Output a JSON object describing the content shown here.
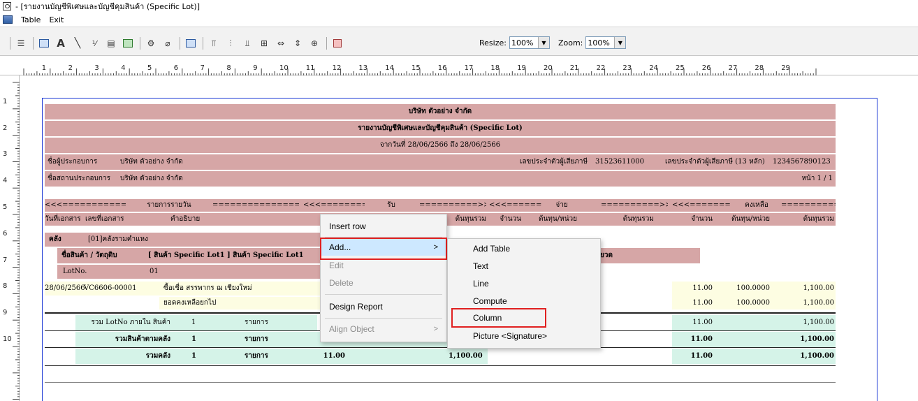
{
  "window": {
    "title": " - [รายงานบัญชีพิเศษและบัญชีคุมสินค้า (Specific Lot)]"
  },
  "menubar": {
    "items": [
      "Table",
      "Exit"
    ]
  },
  "toolbar": {
    "resize_label": "Resize:",
    "resize_value": "100%",
    "zoom_label": "Zoom:",
    "zoom_value": "100%"
  },
  "ruler": {
    "h_marks": [
      "1",
      "2",
      "3",
      "4",
      "5",
      "6",
      "7",
      "8",
      "9",
      "10",
      "11",
      "12",
      "13",
      "14",
      "15",
      "16",
      "17",
      "18",
      "19",
      "20",
      "21",
      "22",
      "23",
      "24",
      "25",
      "26",
      "27",
      "28",
      "29"
    ],
    "v_marks": [
      "1",
      "2",
      "3",
      "4",
      "5",
      "6",
      "7",
      "8",
      "9",
      "10"
    ]
  },
  "report": {
    "company": "บริษัท ตัวอย่าง จำกัด",
    "title": "รายงานบัญชีพิเศษและบัญชีคุมสินค้า (Specific Lot)",
    "date_range": "จากวันที่ 28/06/2566 ถึง 28/06/2566",
    "operator_label": "ชื่อผู้ประกอบการ",
    "operator_value": "บริษัท ตัวอย่าง จำกัด",
    "branch_label": "ชื่อสถานประกอบการ",
    "branch_value": "บริษัท ตัวอย่าง จำกัด",
    "taxid_label": "เลขประจำตัวผู้เสียภาษี",
    "taxid_value": "31523611000",
    "taxid13_label": "เลขประจำตัวผู้เสียภาษี (13 หลัก)",
    "taxid13_value": "1234567890123",
    "page_label": "หน้า 1 / 1",
    "group_daily": "รายการรายวัน",
    "group_receive": "รับ",
    "group_pay": "จ่าย",
    "group_balance": "คงเหลือ",
    "arrow_left_long": "<<<===============",
    "arrow_right_long": "===============>>>",
    "arrow_left_short": "<<<==========",
    "arrow_right_short": "==========>>>",
    "col_doc_date": "วันที่เอกสาร",
    "col_doc_no": "เลขที่เอกสาร",
    "col_desc": "คำอธิบาย",
    "col_total_cost": "ต้นทุนรวม",
    "col_qty": "จำนวน",
    "col_unit_cost": "ต้นทุน/หน่วย",
    "warehouse_label": "คลัง",
    "warehouse_value": "[01]คลังรามคำแหง",
    "product_label": "ชื่อสินค้า / วัตถุดิบ",
    "product_value": "[ สินค้า Specific Lot1 ] สินค้า Specific Lot1",
    "unit_fragment": "ขวด",
    "lot_label": "LotNo.",
    "lot_value": "01",
    "line_date": "28/06/2566",
    "line_doc": "VC6606-00001",
    "line_desc": "ซื้อเชื่อ สรรพากร ฌ เชียงใหม่",
    "carry_label": "ยอดคงเหลือยกไป",
    "bal_qty": "11.00",
    "bal_unit": "100.0000",
    "bal_total": "1,100.00",
    "sum_lot_label": "รวม LotNo ภายใน สินค้า",
    "sum_prod_label": "รวมสินค้าตามคลัง",
    "sum_wh_label": "รวมคลัง",
    "sum_count": "1",
    "sum_unit": "รายการ",
    "sum_qty": "11.00",
    "sum_total": "1,100.00"
  },
  "context_menu": {
    "items": [
      "Insert row",
      "Add...",
      "Edit",
      "Delete",
      "Design Report",
      "Align Object"
    ]
  },
  "submenu": {
    "items": [
      "Add Table",
      "Text",
      "Line",
      "Compute",
      "Column",
      "Picture <Signature>"
    ]
  }
}
